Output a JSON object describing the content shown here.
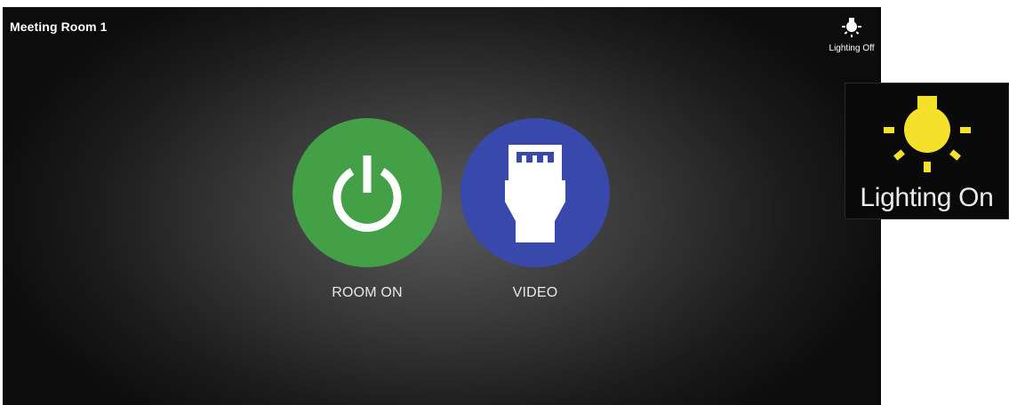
{
  "room": {
    "title": "Meeting Room 1"
  },
  "lighting": {
    "status_label": "Lighting Off",
    "icon": "light-bulb-icon",
    "icon_color": "#ffffff"
  },
  "controls": [
    {
      "label": "ROOM ON",
      "icon": "power-icon",
      "color": "#43a047"
    },
    {
      "label": "VIDEO",
      "icon": "hdmi-connector-icon",
      "color": "#3949ab"
    }
  ],
  "inset": {
    "label": "Lighting On",
    "icon": "light-bulb-icon",
    "icon_color": "#f5e02a"
  }
}
